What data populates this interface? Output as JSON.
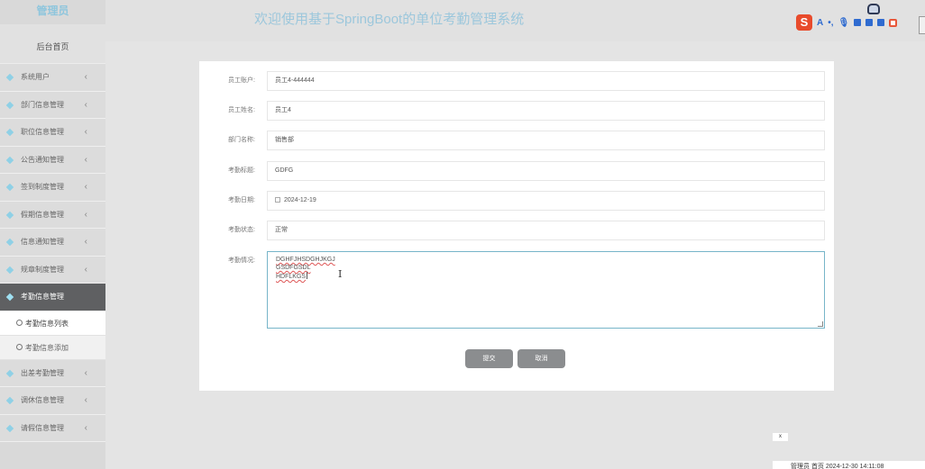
{
  "sidebar": {
    "role": "管理员",
    "home": "后台首页",
    "items": [
      {
        "label": "系统用户"
      },
      {
        "label": "部门信息管理"
      },
      {
        "label": "职位信息管理"
      },
      {
        "label": "公告通知管理"
      },
      {
        "label": "签到制度管理"
      },
      {
        "label": "假期信息管理"
      },
      {
        "label": "信息通知管理"
      },
      {
        "label": "规章制度管理"
      }
    ],
    "active_item": "考勤信息管理",
    "sub_items": [
      {
        "label": "考勤信息列表"
      },
      {
        "label": "考勤信息添加"
      }
    ],
    "after_items": [
      {
        "label": "出差考勤管理"
      },
      {
        "label": "调休信息管理"
      },
      {
        "label": "请假信息管理"
      }
    ]
  },
  "header": {
    "title": "欢迎使用基于SpringBoot的单位考勤管理系统",
    "ime_logo": "S",
    "ime_letter": "A",
    "ime_punct": "•,"
  },
  "form": {
    "fields": [
      {
        "label": "员工账户:",
        "value": "员工4-444444"
      },
      {
        "label": "员工姓名:",
        "value": "员工4"
      },
      {
        "label": "部门名称:",
        "value": "销售部"
      },
      {
        "label": "考勤标题:",
        "value": "GDFG"
      },
      {
        "label": "考勤日期:",
        "value": "2024-12-19"
      },
      {
        "label": "考勤状态:",
        "value": "正常"
      }
    ],
    "textarea_label": "考勤情况:",
    "textarea_lines": [
      "DGHFJHSDGHJKGJ",
      "GSDFGSDL",
      "HDFLKGS"
    ],
    "submit_label": "提交",
    "cancel_label": "取消"
  },
  "footer": {
    "close": "x",
    "status": "管理员  首页 2024-12-30 14:11:08"
  },
  "colors": {
    "accent": "#9cc7dc",
    "active_bg": "#5f6062",
    "button_bg": "#8b8d8f"
  }
}
